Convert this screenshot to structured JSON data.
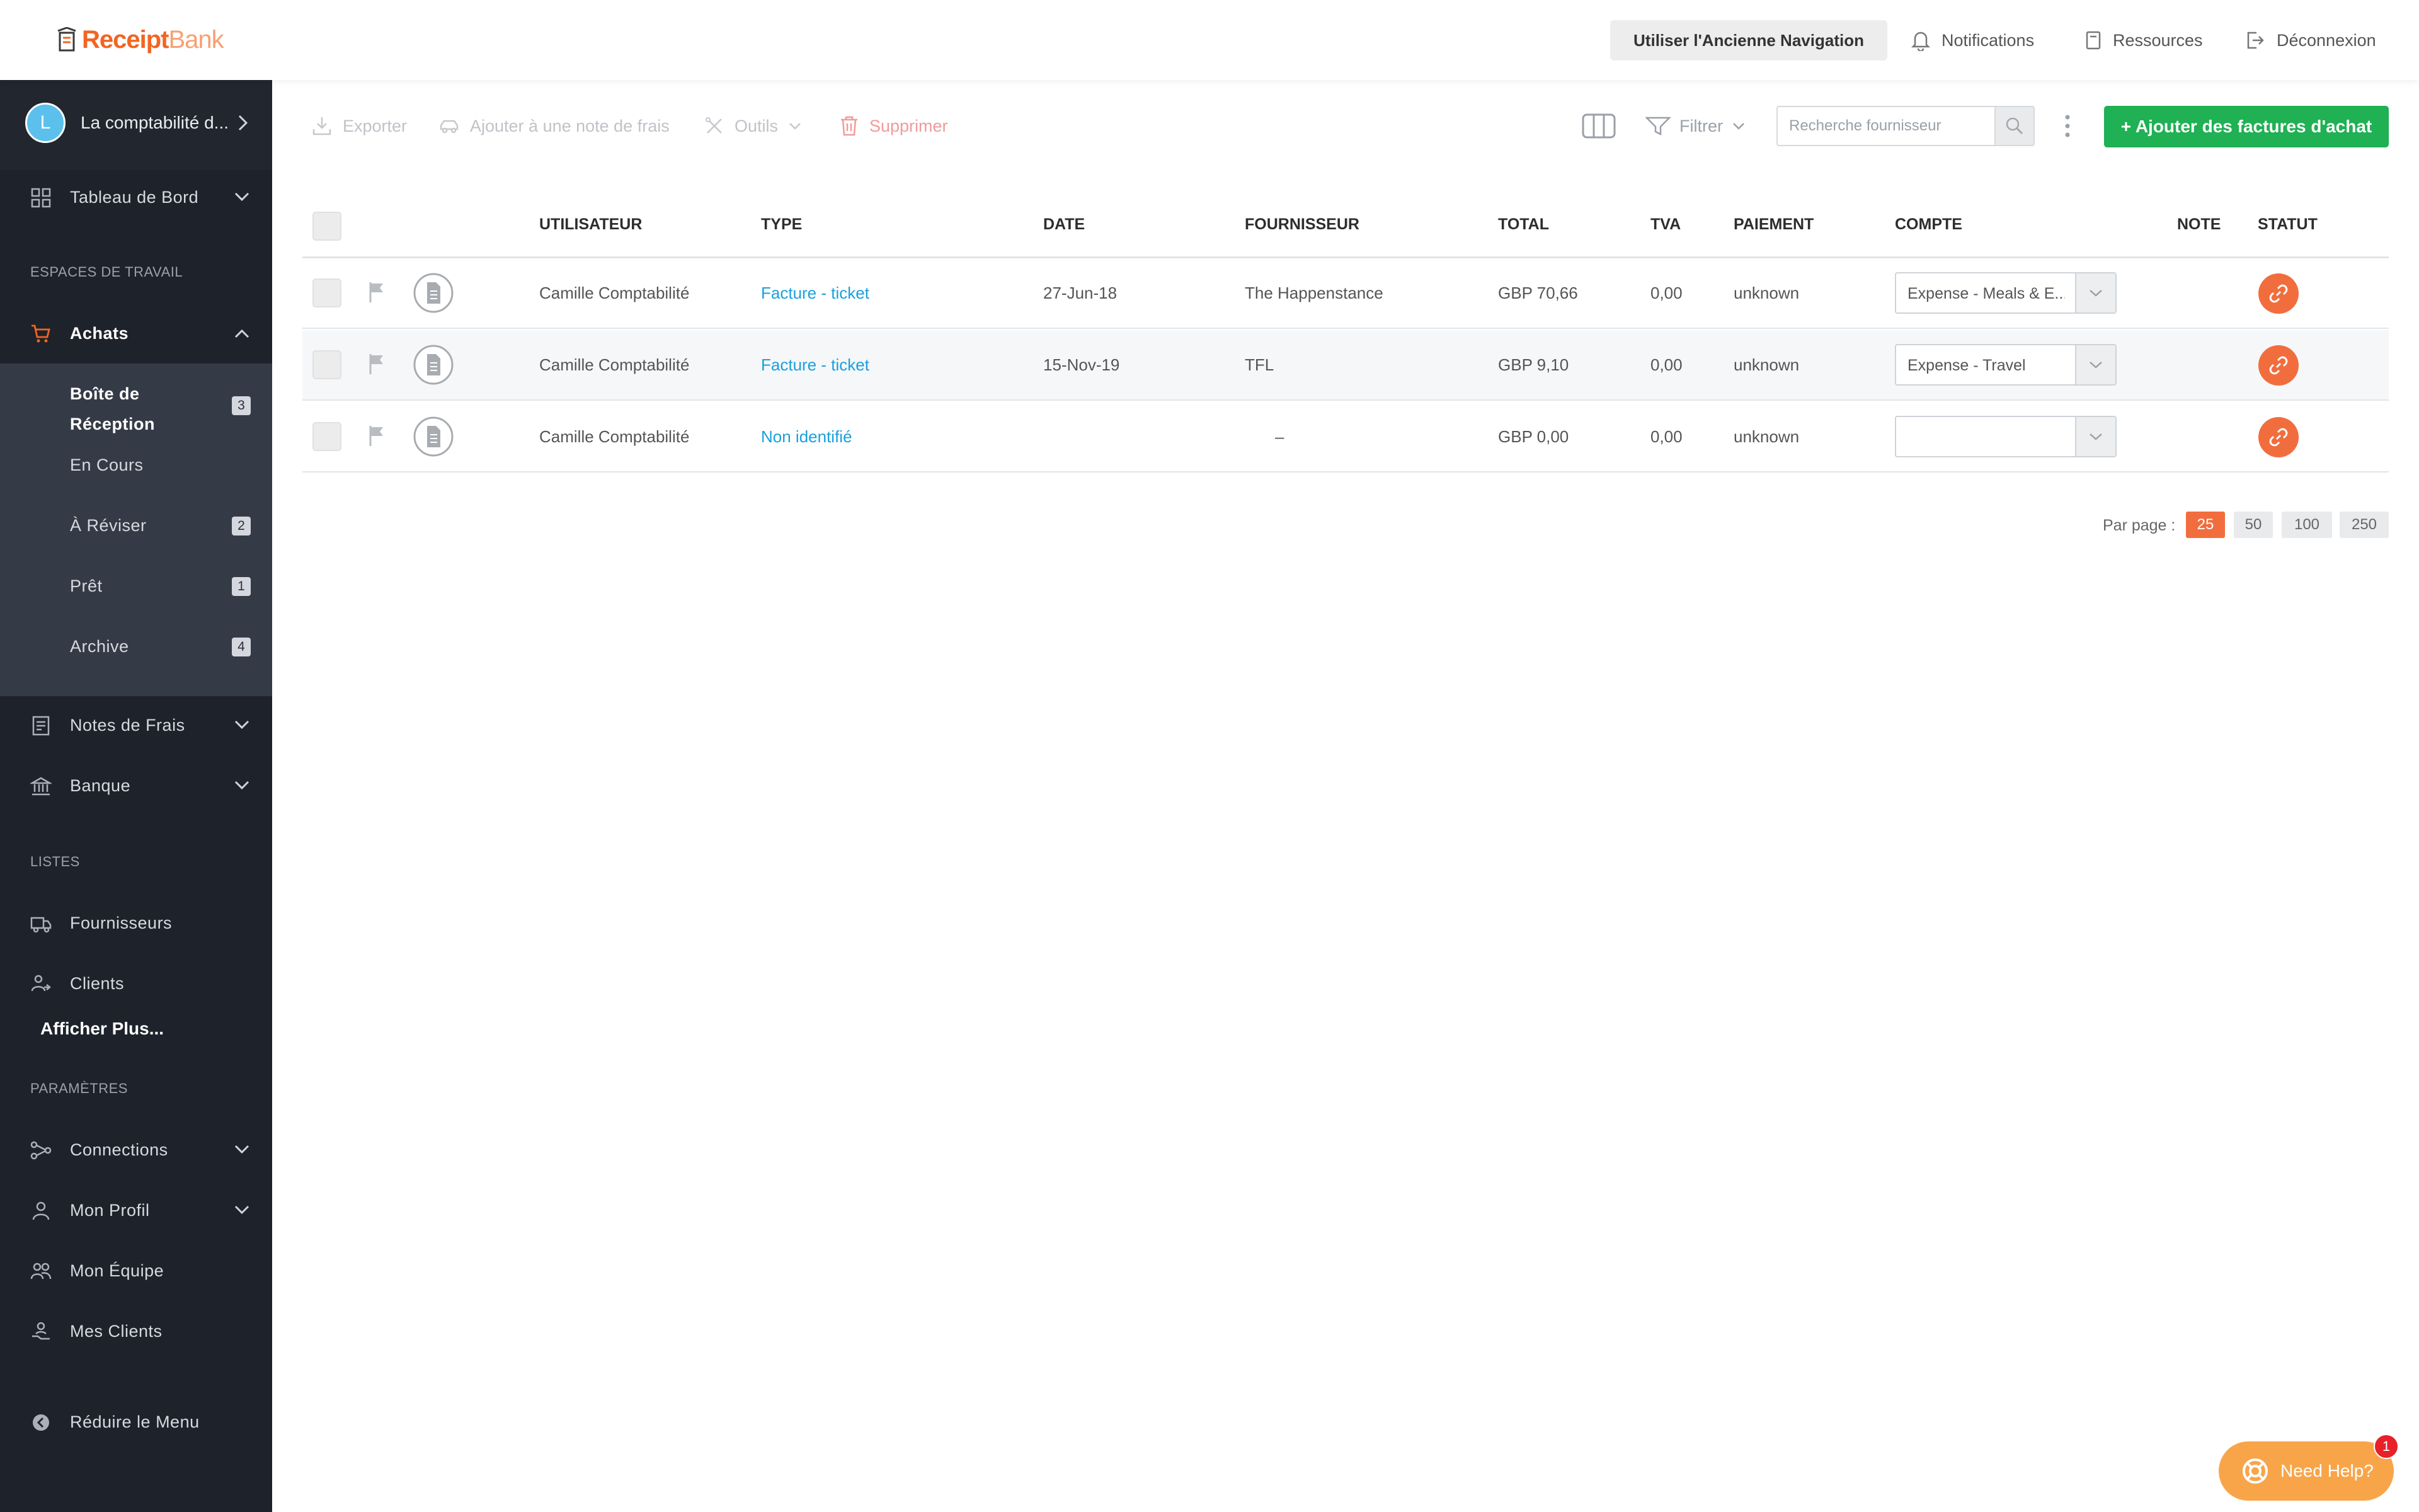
{
  "brand": {
    "logo_main": "Receipt",
    "logo_sub": "Bank",
    "accent": "#f26522",
    "green": "#1fb153"
  },
  "topbar": {
    "old_nav_label": "Utiliser l'Ancienne Navigation",
    "notifications": "Notifications",
    "resources": "Ressources",
    "logout": "Déconnexion"
  },
  "sidebar": {
    "account": {
      "avatar_letter": "L",
      "name": "La comptabilité d..."
    },
    "dashboard": "Tableau de Bord",
    "workspaces_label": "ESPACES DE TRAVAIL",
    "purchases": "Achats",
    "sub_items": [
      {
        "label_line1": "Boîte de",
        "label_line2": "Réception",
        "count": "3"
      },
      {
        "label": "En Cours"
      },
      {
        "label": "À Réviser",
        "count": "2"
      },
      {
        "label": "Prêt",
        "count": "1"
      },
      {
        "label": "Archive",
        "count": "4"
      }
    ],
    "expense_reports": "Notes de Frais",
    "bank": "Banque",
    "lists_label": "LISTES",
    "suppliers": "Fournisseurs",
    "clients": "Clients",
    "show_more": "Afficher Plus...",
    "settings_label": "PARAMÈTRES",
    "connections": "Connections",
    "my_profile": "Mon Profil",
    "my_team": "Mon Équipe",
    "my_clients": "Mes Clients",
    "collapse": "Réduire le Menu"
  },
  "toolbar": {
    "export": "Exporter",
    "add_to_report": "Ajouter à une note de frais",
    "tools": "Outils",
    "delete": "Supprimer",
    "filter": "Filtrer",
    "search_placeholder": "Recherche fournisseur",
    "add_button": "+ Ajouter des factures d'achat"
  },
  "table": {
    "columns": [
      "UTILISATEUR",
      "TYPE",
      "DATE",
      "FOURNISSEUR",
      "TOTAL",
      "TVA",
      "PAIEMENT",
      "COMPTE",
      "NOTE",
      "STATUT"
    ],
    "rows": [
      {
        "user": "Camille Comptabilité",
        "type": "Facture - ticket",
        "date": "27-Jun-18",
        "supplier": "The Happenstance",
        "total": "GBP 70,66",
        "tva": "0,00",
        "payment": "unknown",
        "account": "Expense - Meals & E..."
      },
      {
        "user": "Camille Comptabilité",
        "type": "Facture - ticket",
        "date": "15-Nov-19",
        "supplier": "TFL",
        "total": "GBP 9,10",
        "tva": "0,00",
        "payment": "unknown",
        "account": "Expense - Travel"
      },
      {
        "user": "Camille Comptabilité",
        "type": "Non identifié",
        "date": "",
        "supplier": "–",
        "total": "GBP 0,00",
        "tva": "0,00",
        "payment": "unknown",
        "account": ""
      }
    ]
  },
  "pagination": {
    "label": "Par page :",
    "options": [
      "25",
      "50",
      "100",
      "250"
    ],
    "selected": "25"
  },
  "help": {
    "label": "Need Help?",
    "badge": "1"
  }
}
